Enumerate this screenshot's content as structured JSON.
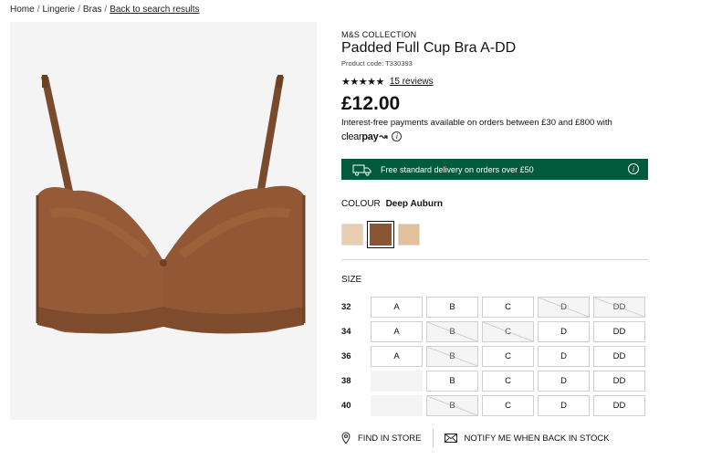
{
  "breadcrumb": {
    "items": [
      "Home",
      "Lingerie",
      "Bras"
    ],
    "separator": "/",
    "back": "Back to search results"
  },
  "product": {
    "brand": "M&S COLLECTION",
    "title": "Padded Full Cup Bra A-DD",
    "code": "Product code: T330393",
    "stars": "★★★★★",
    "reviews": "15 reviews",
    "price": "£12.00",
    "interest": "Interest-free payments available on orders between £30 and £800 with",
    "clearpay_a": "clear",
    "clearpay_b": "pay",
    "clearpay_mark": "↝",
    "info_glyph": "i"
  },
  "delivery": {
    "message": "Free standard delivery on orders over £50",
    "icon": "truck-icon",
    "bg_color": "#005a3c"
  },
  "colour": {
    "label": "COLOUR",
    "selected": "Deep Auburn",
    "swatches": [
      {
        "name": "Light Beige",
        "color": "#e8cdb0"
      },
      {
        "name": "Deep Auburn",
        "color": "#8a5535"
      },
      {
        "name": "Almond",
        "color": "#e2c09a"
      }
    ]
  },
  "size": {
    "label": "SIZE",
    "cups": [
      "A",
      "B",
      "C",
      "D",
      "DD"
    ],
    "rows": [
      {
        "band": "32",
        "status": [
          "in",
          "in",
          "in",
          "oos",
          "oos"
        ]
      },
      {
        "band": "34",
        "status": [
          "in",
          "oos",
          "oos",
          "in",
          "in"
        ]
      },
      {
        "band": "36",
        "status": [
          "in",
          "oos",
          "in",
          "in",
          "in"
        ]
      },
      {
        "band": "38",
        "status": [
          "none",
          "in",
          "in",
          "in",
          "in"
        ]
      },
      {
        "band": "40",
        "status": [
          "none",
          "oos",
          "in",
          "in",
          "in"
        ]
      }
    ]
  },
  "actions": {
    "find_in_store": "FIND IN STORE",
    "notify": "NOTIFY ME WHEN BACK IN STOCK"
  }
}
